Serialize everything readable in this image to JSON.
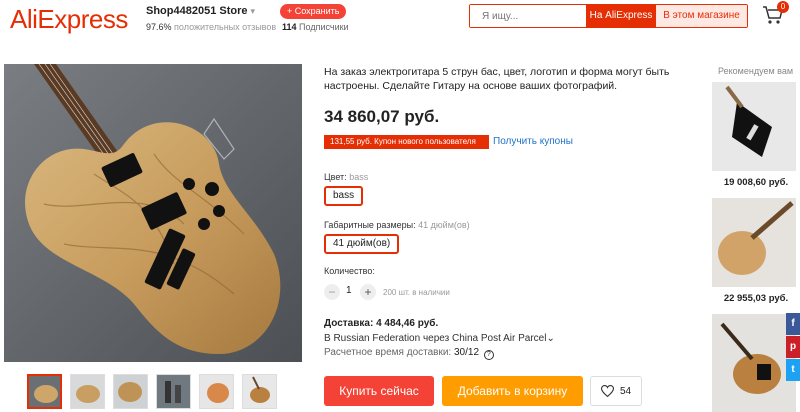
{
  "header": {
    "logo": "AliExpress",
    "store_name": "Shop4482051 Store",
    "store_caret": "▾",
    "positive_percent": "97.6%",
    "positive_label": "положительных отзывов",
    "follow_label": "+ Сохранить",
    "subscribers_count": "114",
    "subscribers_label": "Подписчики",
    "search_placeholder": "Я ищу...",
    "search_on_ali": "На AliExpress",
    "search_in_store": "В этом магазине",
    "cart_count": "0"
  },
  "product": {
    "title": "На заказ электрогитара 5 струн бас, цвет, логотип и форма могут быть настроены. Сделайте Гитару на основе ваших фотографий.",
    "price": "34 860,07 руб.",
    "coupon_tag": "131,55 руб. Купон нового пользователя",
    "get_coupons": "Получить купоны",
    "color_label": "Цвет:",
    "color_value": "bass",
    "color_option": "bass",
    "size_label": "Габаритные размеры:",
    "size_value": "41 дюйм(ов)",
    "size_option": "41 дюйм(ов)",
    "qty_label": "Количество:",
    "qty_minus": "−",
    "qty_value": "1",
    "qty_plus": "+",
    "available": "200 шт. в наличии",
    "shipping_title": "Доставка: 4 484,46 руб.",
    "shipping_line": "В Russian Federation через China Post Air Parcel",
    "shipping_caret": "⌄",
    "eta_label": "Расчетное время доставки:",
    "eta_value": "30/12",
    "eta_help": "?",
    "buy_now": "Купить сейчас",
    "add_to_cart": "Добавить в корзину",
    "wishlist_count": "54"
  },
  "recommend": {
    "title": "Рекомендуем вам",
    "items": [
      {
        "price": "19 008,60 руб."
      },
      {
        "price": "22 955,03 руб."
      }
    ]
  },
  "social": {
    "fb": "f",
    "pin": "p",
    "tw": "t"
  },
  "colors": {
    "accent": "#e62e04",
    "buy": "#f44336",
    "cart": "#ff9c00",
    "link": "#2272c9"
  }
}
